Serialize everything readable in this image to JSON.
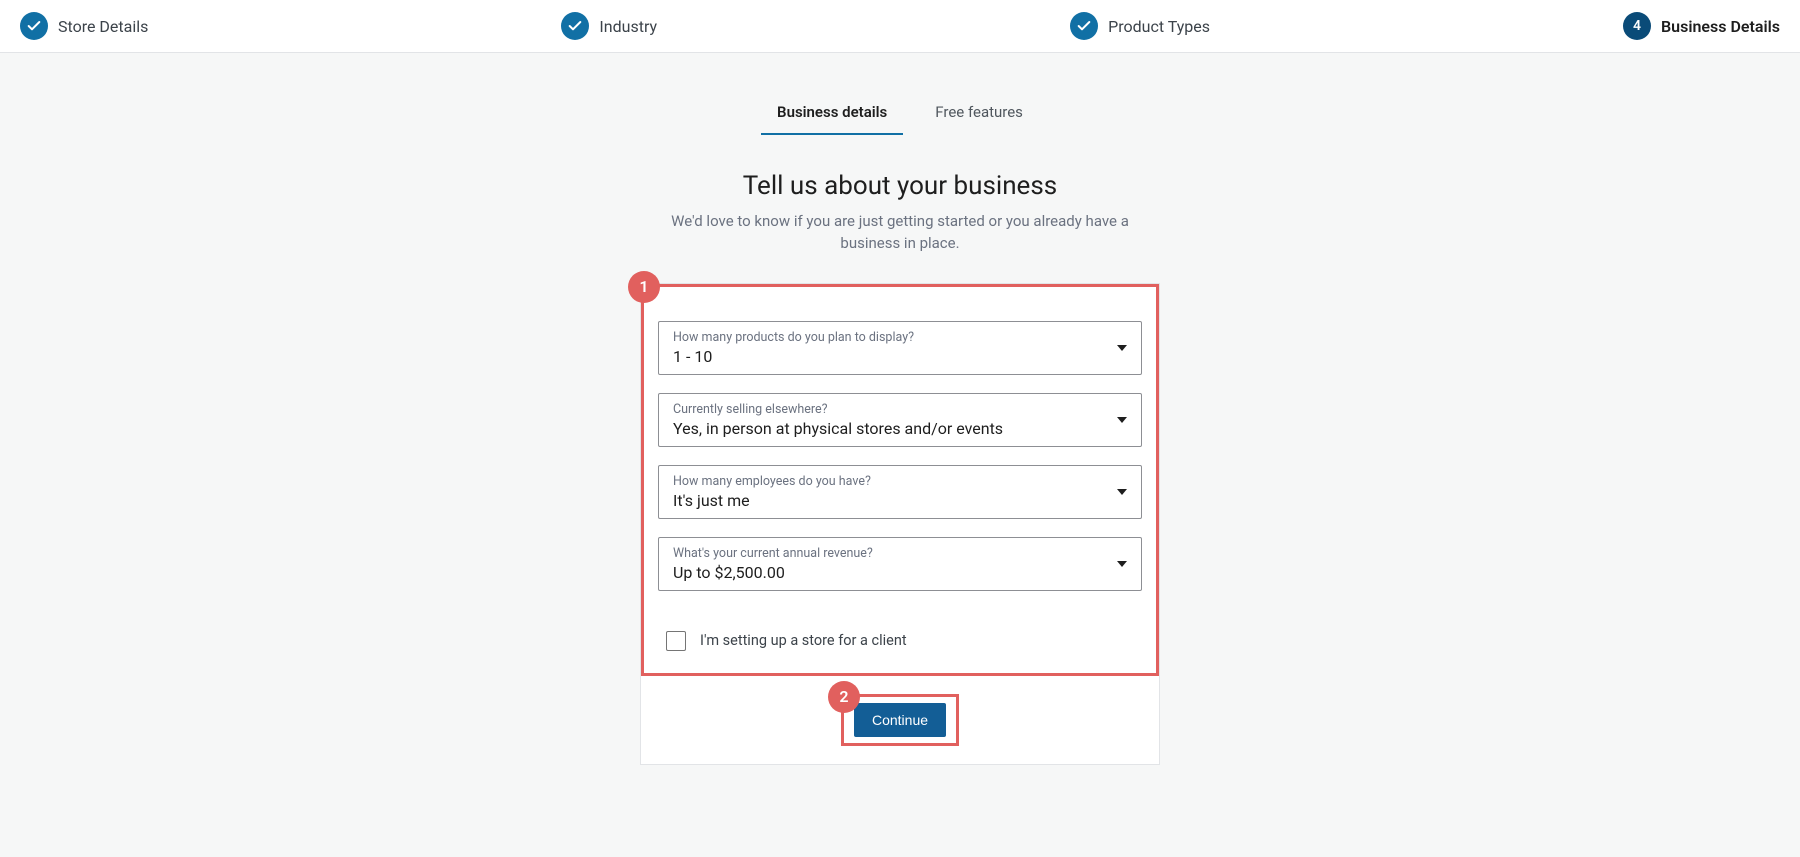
{
  "stepper": {
    "steps": [
      {
        "label": "Store Details",
        "done": true
      },
      {
        "label": "Industry",
        "done": true
      },
      {
        "label": "Product Types",
        "done": true
      },
      {
        "label": "Business Details",
        "number": "4",
        "current": true
      }
    ]
  },
  "tabs": {
    "items": [
      {
        "label": "Business details",
        "active": true
      },
      {
        "label": "Free features",
        "active": false
      }
    ]
  },
  "headline": {
    "title": "Tell us about your business",
    "subtitle": "We'd love to know if you are just getting started or you already have a business in place."
  },
  "form": {
    "fields": [
      {
        "label": "How many products do you plan to display?",
        "value": "1 - 10"
      },
      {
        "label": "Currently selling elsewhere?",
        "value": "Yes, in person at physical stores and/or events"
      },
      {
        "label": "How many employees do you have?",
        "value": "It's just me"
      },
      {
        "label": "What's your current annual revenue?",
        "value": "Up to $2,500.00"
      }
    ],
    "checkbox_label": "I'm setting up a store for a client",
    "continue_label": "Continue"
  },
  "annotations": {
    "badge1": "1",
    "badge2": "2"
  }
}
